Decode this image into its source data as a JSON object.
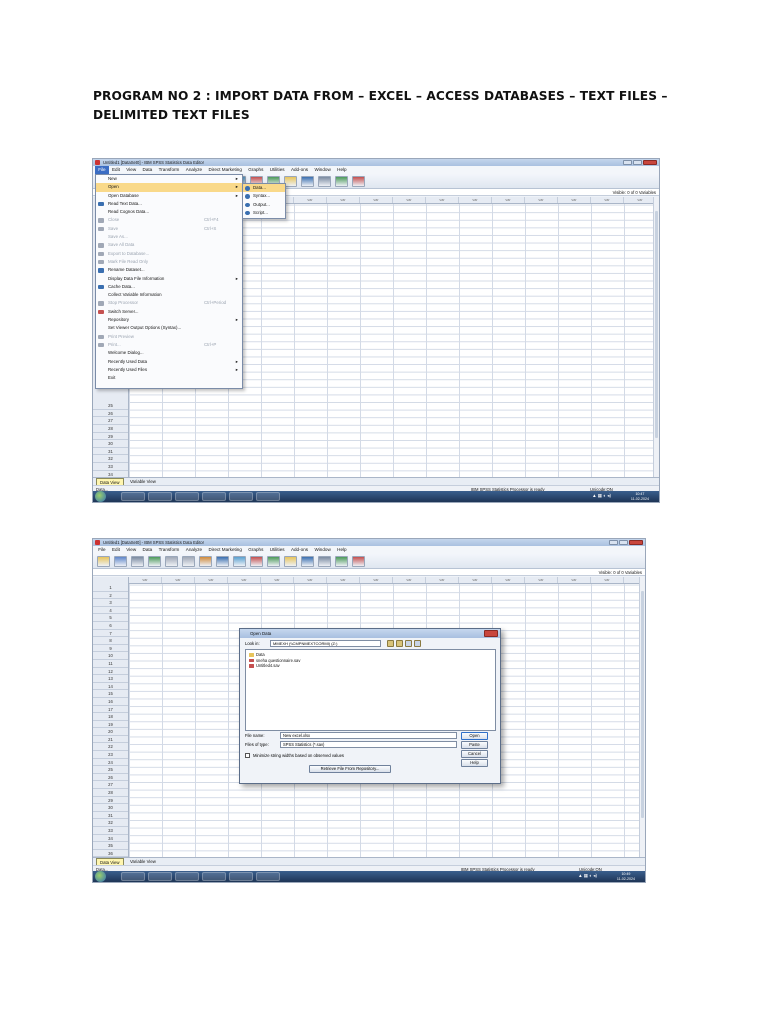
{
  "doc": {
    "heading": "PROGRAM NO 2 : IMPORT DATA FROM – EXCEL – ACCESS DATABASES – TEXT FILES – DELIMITED TEXT FILES"
  },
  "colors": {
    "accent": "#3b6dc4",
    "menu_highlight": "#f9d98a",
    "active_tab": "#fff6b0",
    "taskbar": "#1e3556"
  },
  "screenshot1": {
    "window_title": "Untitled1 [DataSet0] - IBM SPSS Statistics Data Editor",
    "menubar": [
      "File",
      "Edit",
      "View",
      "Data",
      "Transform",
      "Analyze",
      "Direct Marketing",
      "Graphs",
      "Utilities",
      "Add-ons",
      "Window",
      "Help"
    ],
    "visible": "Visible: 0 of 0 Variables",
    "column_header": "var",
    "file_menu": [
      {
        "label": "New",
        "shortcut": "",
        "arrow": "▸",
        "state": "normal",
        "icon": ""
      },
      {
        "label": "Open",
        "shortcut": "",
        "arrow": "▸",
        "state": "highlight",
        "icon": ""
      },
      {
        "label": "Open Database",
        "shortcut": "",
        "arrow": "▸",
        "state": "normal",
        "icon": ""
      },
      {
        "label": "Read Text Data...",
        "shortcut": "",
        "arrow": "",
        "state": "normal",
        "icon": "text-file-icon"
      },
      {
        "label": "Read Cognos Data...",
        "shortcut": "",
        "arrow": "",
        "state": "normal",
        "icon": ""
      },
      {
        "label": "Close",
        "shortcut": "Ctrl+F4",
        "arrow": "",
        "state": "disabled",
        "icon": "close-file-icon"
      },
      {
        "label": "Save",
        "shortcut": "Ctrl+S",
        "arrow": "",
        "state": "disabled",
        "icon": "save-icon"
      },
      {
        "label": "Save As...",
        "shortcut": "",
        "arrow": "",
        "state": "disabled",
        "icon": ""
      },
      {
        "label": "Save All Data",
        "shortcut": "",
        "arrow": "",
        "state": "disabled",
        "icon": "save-all-icon"
      },
      {
        "label": "Export to Database...",
        "shortcut": "",
        "arrow": "",
        "state": "disabled",
        "icon": "export-database-icon"
      },
      {
        "label": "Mark File Read Only",
        "shortcut": "",
        "arrow": "",
        "state": "disabled",
        "icon": "read-only-icon"
      },
      {
        "label": "Rename Dataset...",
        "shortcut": "",
        "arrow": "",
        "state": "normal",
        "icon": "rename-dataset-icon"
      },
      {
        "label": "Display Data File Information",
        "shortcut": "",
        "arrow": "▸",
        "state": "normal",
        "icon": ""
      },
      {
        "label": "Cache Data...",
        "shortcut": "",
        "arrow": "",
        "state": "normal",
        "icon": "cache-data-icon"
      },
      {
        "label": "Collect Variable Information",
        "shortcut": "",
        "arrow": "",
        "state": "normal",
        "icon": ""
      },
      {
        "label": "Stop Processor",
        "shortcut": "Ctrl+Period",
        "arrow": "",
        "state": "disabled",
        "icon": "stop-processor-icon"
      },
      {
        "label": "Switch Server...",
        "shortcut": "",
        "arrow": "",
        "state": "normal",
        "icon": "switch-server-icon"
      },
      {
        "label": "Repository",
        "shortcut": "",
        "arrow": "▸",
        "state": "normal",
        "icon": ""
      },
      {
        "label": "Set Viewer Output Options (Syntax)...",
        "shortcut": "",
        "arrow": "",
        "state": "normal",
        "icon": ""
      },
      {
        "label": "Print Preview",
        "shortcut": "",
        "arrow": "",
        "state": "disabled",
        "icon": "print-preview-icon"
      },
      {
        "label": "Print...",
        "shortcut": "Ctrl+P",
        "arrow": "",
        "state": "disabled",
        "icon": "print-icon"
      },
      {
        "label": "Welcome Dialog...",
        "shortcut": "",
        "arrow": "",
        "state": "normal",
        "icon": ""
      },
      {
        "label": "Recently Used Data",
        "shortcut": "",
        "arrow": "▸",
        "state": "normal",
        "icon": ""
      },
      {
        "label": "Recently Used Files",
        "shortcut": "",
        "arrow": "▸",
        "state": "normal",
        "icon": ""
      },
      {
        "label": "Exit",
        "shortcut": "",
        "arrow": "",
        "state": "normal",
        "icon": ""
      }
    ],
    "open_submenu": [
      "Data...",
      "Syntax...",
      "Output...",
      "Script..."
    ],
    "row_numbers": [
      "25",
      "26",
      "27",
      "28",
      "29",
      "30",
      "31",
      "32",
      "33",
      "34",
      "35"
    ],
    "tabs": [
      "Data View",
      "Variable View"
    ],
    "status": {
      "left": "Data...",
      "processor": "IBM SPSS Statistics Processor is ready",
      "unicode": "Unicode:ON"
    },
    "clock": {
      "time": "10:47",
      "date": "11-02-2024"
    }
  },
  "screenshot2": {
    "window_title": "Untitled1 [DataSet0] - IBM SPSS Statistics Data Editor",
    "menubar": [
      "File",
      "Edit",
      "View",
      "Data",
      "Transform",
      "Analyze",
      "Direct Marketing",
      "Graphs",
      "Utilities",
      "Add-ons",
      "Window",
      "Help"
    ],
    "visible": "Visible: 0 of 0 Variables",
    "column_header": "var",
    "row_numbers": [
      "1",
      "2",
      "3",
      "4",
      "5",
      "6",
      "7",
      "8",
      "9",
      "10",
      "11",
      "12",
      "13",
      "14",
      "15",
      "16",
      "17",
      "18",
      "19",
      "20",
      "21",
      "22",
      "23",
      "24",
      "25",
      "26",
      "27",
      "28",
      "29",
      "30",
      "31",
      "32",
      "33",
      "34",
      "35",
      "36"
    ],
    "dialog": {
      "title": "Open Data",
      "look_in_label": "Look in:",
      "look_in_value": "MMEXH (\\\\CMPNMEXTCORMI) (Z:)",
      "files": [
        "Data",
        "sneha questionnaire.sav",
        "Untitled4.sav"
      ],
      "file_name_label": "File name:",
      "file_name_value": "New excel.xlsx",
      "file_type_label": "Files of type:",
      "file_type_value": "SPSS Statistics (*.sav)",
      "encoding_label": "Encoding:",
      "encoding_value": "",
      "checkbox_label": "Minimize string widths based on observed values",
      "buttons": [
        "Open",
        "Paste",
        "Cancel",
        "Help"
      ],
      "retrieve_button": "Retrieve File From Repository..."
    },
    "tabs": [
      "Data View",
      "Variable View"
    ],
    "status": {
      "left": "Data...",
      "processor": "IBM SPSS Statistics Processor is ready",
      "unicode": "Unicode:ON"
    },
    "clock": {
      "time": "10:49",
      "date": "11-02-2024"
    }
  }
}
